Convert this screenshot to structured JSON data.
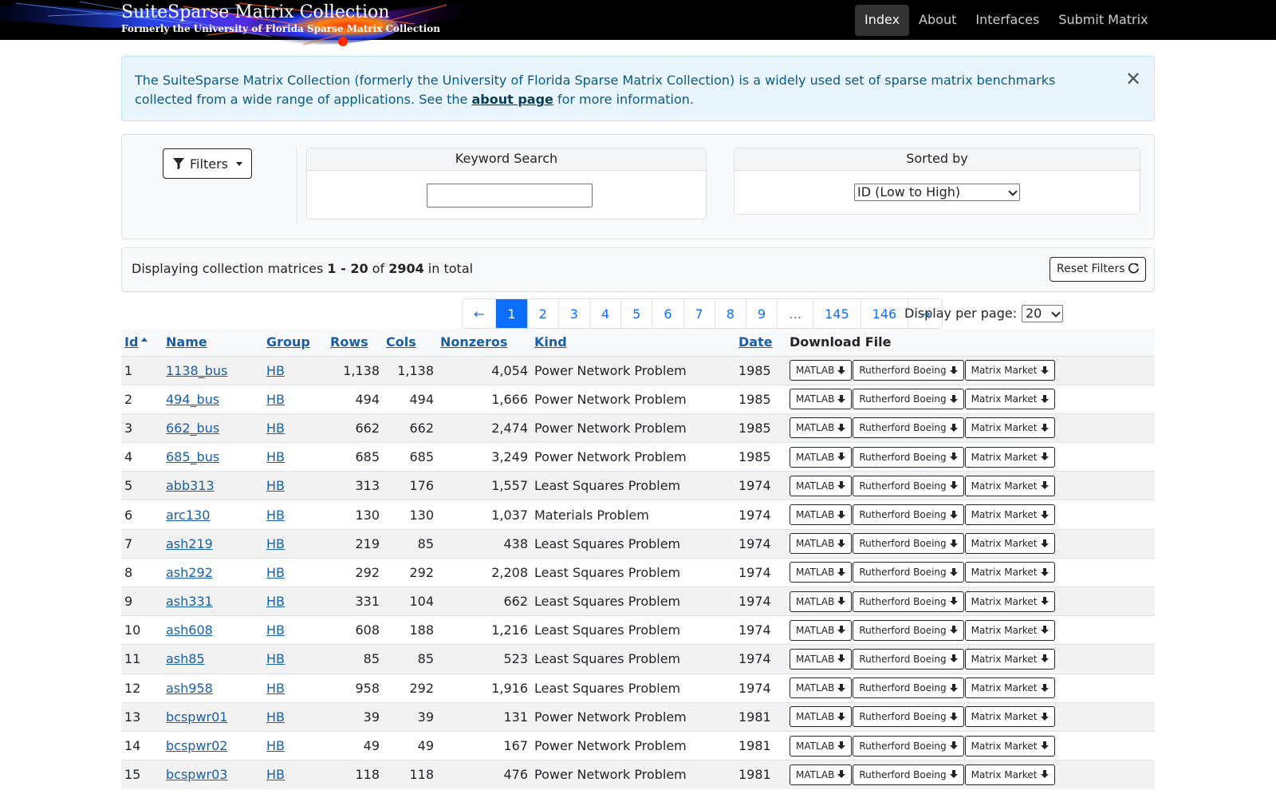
{
  "brand": {
    "title": "SuiteSparse Matrix Collection",
    "subtitle": "Formerly the University of Florida Sparse Matrix Collection"
  },
  "nav": {
    "links": [
      {
        "label": "Index",
        "active": true
      },
      {
        "label": "About",
        "active": false
      },
      {
        "label": "Interfaces",
        "active": false
      },
      {
        "label": "Submit Matrix",
        "active": false
      }
    ]
  },
  "alert": {
    "text_before": "The SuiteSparse Matrix Collection (formerly the University of Florida Sparse Matrix Collection) is a widely used set of sparse matrix benchmarks collected from a wide range of applications. See the ",
    "link": "about page",
    "text_after": " for more information.",
    "close_glyph": "✕"
  },
  "search": {
    "filters_label": "Filters",
    "keyword_header": "Keyword Search",
    "keyword_value": "",
    "sort_header": "Sorted by",
    "sort_value": "ID (Low to High)"
  },
  "summary": {
    "prefix": "Displaying collection matrices ",
    "range": "1 - 20",
    "of": " of ",
    "total": "2904",
    "suffix": " in total",
    "reset_label": "Reset Filters"
  },
  "pagination": {
    "items": [
      "←",
      "1",
      "2",
      "3",
      "4",
      "5",
      "6",
      "7",
      "8",
      "9",
      "…",
      "145",
      "146",
      "→"
    ],
    "active": "1",
    "per_page_label": "Display per page:",
    "per_page_value": "20"
  },
  "table": {
    "headers": {
      "id": "Id",
      "name": "Name",
      "group": "Group",
      "rows": "Rows",
      "cols": "Cols",
      "nonzeros": "Nonzeros",
      "kind": "Kind",
      "date": "Date",
      "download": "Download File"
    },
    "download_labels": [
      "MATLAB",
      "Rutherford Boeing",
      "Matrix Market"
    ],
    "rows": [
      {
        "id": "1",
        "name": "1138_bus",
        "group": "HB",
        "rows": "1,138",
        "cols": "1,138",
        "nnz": "4,054",
        "kind": "Power Network Problem",
        "date": "1985"
      },
      {
        "id": "2",
        "name": "494_bus",
        "group": "HB",
        "rows": "494",
        "cols": "494",
        "nnz": "1,666",
        "kind": "Power Network Problem",
        "date": "1985"
      },
      {
        "id": "3",
        "name": "662_bus",
        "group": "HB",
        "rows": "662",
        "cols": "662",
        "nnz": "2,474",
        "kind": "Power Network Problem",
        "date": "1985"
      },
      {
        "id": "4",
        "name": "685_bus",
        "group": "HB",
        "rows": "685",
        "cols": "685",
        "nnz": "3,249",
        "kind": "Power Network Problem",
        "date": "1985"
      },
      {
        "id": "5",
        "name": "abb313",
        "group": "HB",
        "rows": "313",
        "cols": "176",
        "nnz": "1,557",
        "kind": "Least Squares Problem",
        "date": "1974"
      },
      {
        "id": "6",
        "name": "arc130",
        "group": "HB",
        "rows": "130",
        "cols": "130",
        "nnz": "1,037",
        "kind": "Materials Problem",
        "date": "1974"
      },
      {
        "id": "7",
        "name": "ash219",
        "group": "HB",
        "rows": "219",
        "cols": "85",
        "nnz": "438",
        "kind": "Least Squares Problem",
        "date": "1974"
      },
      {
        "id": "8",
        "name": "ash292",
        "group": "HB",
        "rows": "292",
        "cols": "292",
        "nnz": "2,208",
        "kind": "Least Squares Problem",
        "date": "1974"
      },
      {
        "id": "9",
        "name": "ash331",
        "group": "HB",
        "rows": "331",
        "cols": "104",
        "nnz": "662",
        "kind": "Least Squares Problem",
        "date": "1974"
      },
      {
        "id": "10",
        "name": "ash608",
        "group": "HB",
        "rows": "608",
        "cols": "188",
        "nnz": "1,216",
        "kind": "Least Squares Problem",
        "date": "1974"
      },
      {
        "id": "11",
        "name": "ash85",
        "group": "HB",
        "rows": "85",
        "cols": "85",
        "nnz": "523",
        "kind": "Least Squares Problem",
        "date": "1974"
      },
      {
        "id": "12",
        "name": "ash958",
        "group": "HB",
        "rows": "958",
        "cols": "292",
        "nnz": "1,916",
        "kind": "Least Squares Problem",
        "date": "1974"
      },
      {
        "id": "13",
        "name": "bcspwr01",
        "group": "HB",
        "rows": "39",
        "cols": "39",
        "nnz": "131",
        "kind": "Power Network Problem",
        "date": "1981"
      },
      {
        "id": "14",
        "name": "bcspwr02",
        "group": "HB",
        "rows": "49",
        "cols": "49",
        "nnz": "167",
        "kind": "Power Network Problem",
        "date": "1981"
      },
      {
        "id": "15",
        "name": "bcspwr03",
        "group": "HB",
        "rows": "118",
        "cols": "118",
        "nnz": "476",
        "kind": "Power Network Problem",
        "date": "1981"
      }
    ]
  }
}
